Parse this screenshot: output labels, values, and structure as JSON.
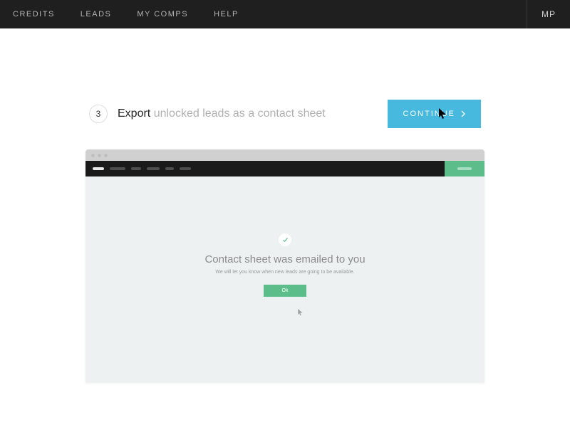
{
  "topnav": {
    "items": [
      "CREDITS",
      "LEADS",
      "MY COMPS",
      "HELP"
    ],
    "avatar_initials": "MP"
  },
  "step": {
    "number": "3",
    "title": "Export",
    "subtitle": "unlocked leads as a contact sheet",
    "continue_label": "CONTINUE"
  },
  "mockup": {
    "confirmation_title": "Contact sheet was emailed to you",
    "confirmation_sub": "We will let you know when new leads are going to be available.",
    "ok_label": "Ok"
  },
  "colors": {
    "accent_blue": "#47b9df",
    "accent_green": "#5cbd8a"
  }
}
